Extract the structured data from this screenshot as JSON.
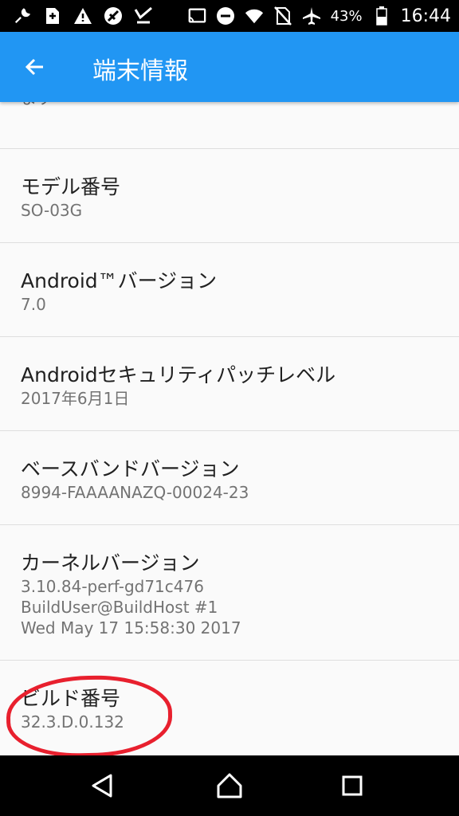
{
  "status_bar": {
    "left_icons": [
      "wrench-icon",
      "sim-icon",
      "warning-icon",
      "signal-off-icon",
      "check-mark-icon"
    ],
    "right_icons": [
      "cast-icon",
      "do-not-disturb-icon",
      "wifi-icon",
      "no-sim-icon",
      "airplane-icon",
      "battery-icon"
    ],
    "battery": "43%",
    "time": "16:44"
  },
  "app_bar": {
    "title": "端末情報",
    "color": "#2196f3"
  },
  "partial_item": {
    "text_line2": "ます"
  },
  "items": [
    {
      "title": "モデル番号",
      "subtitle": "SO-03G"
    },
    {
      "title": "Android™バージョン",
      "subtitle": "7.0"
    },
    {
      "title": "Androidセキュリティパッチレベル",
      "subtitle": "2017年6月1日"
    },
    {
      "title": "ベースバンドバージョン",
      "subtitle": "8994-FAAAANAZQ-00024-23"
    },
    {
      "title": "カーネルバージョン",
      "subtitle_lines": [
        "3.10.84-perf-gd71c476",
        "BuildUser@BuildHost #1",
        "Wed May 17 15:58:30 2017"
      ]
    },
    {
      "title": "ビルド番号",
      "subtitle": "32.3.D.0.132"
    }
  ],
  "annotation_color": "#e8202e",
  "nav_bar": {
    "buttons": [
      "back-icon",
      "home-icon",
      "recents-icon"
    ]
  }
}
